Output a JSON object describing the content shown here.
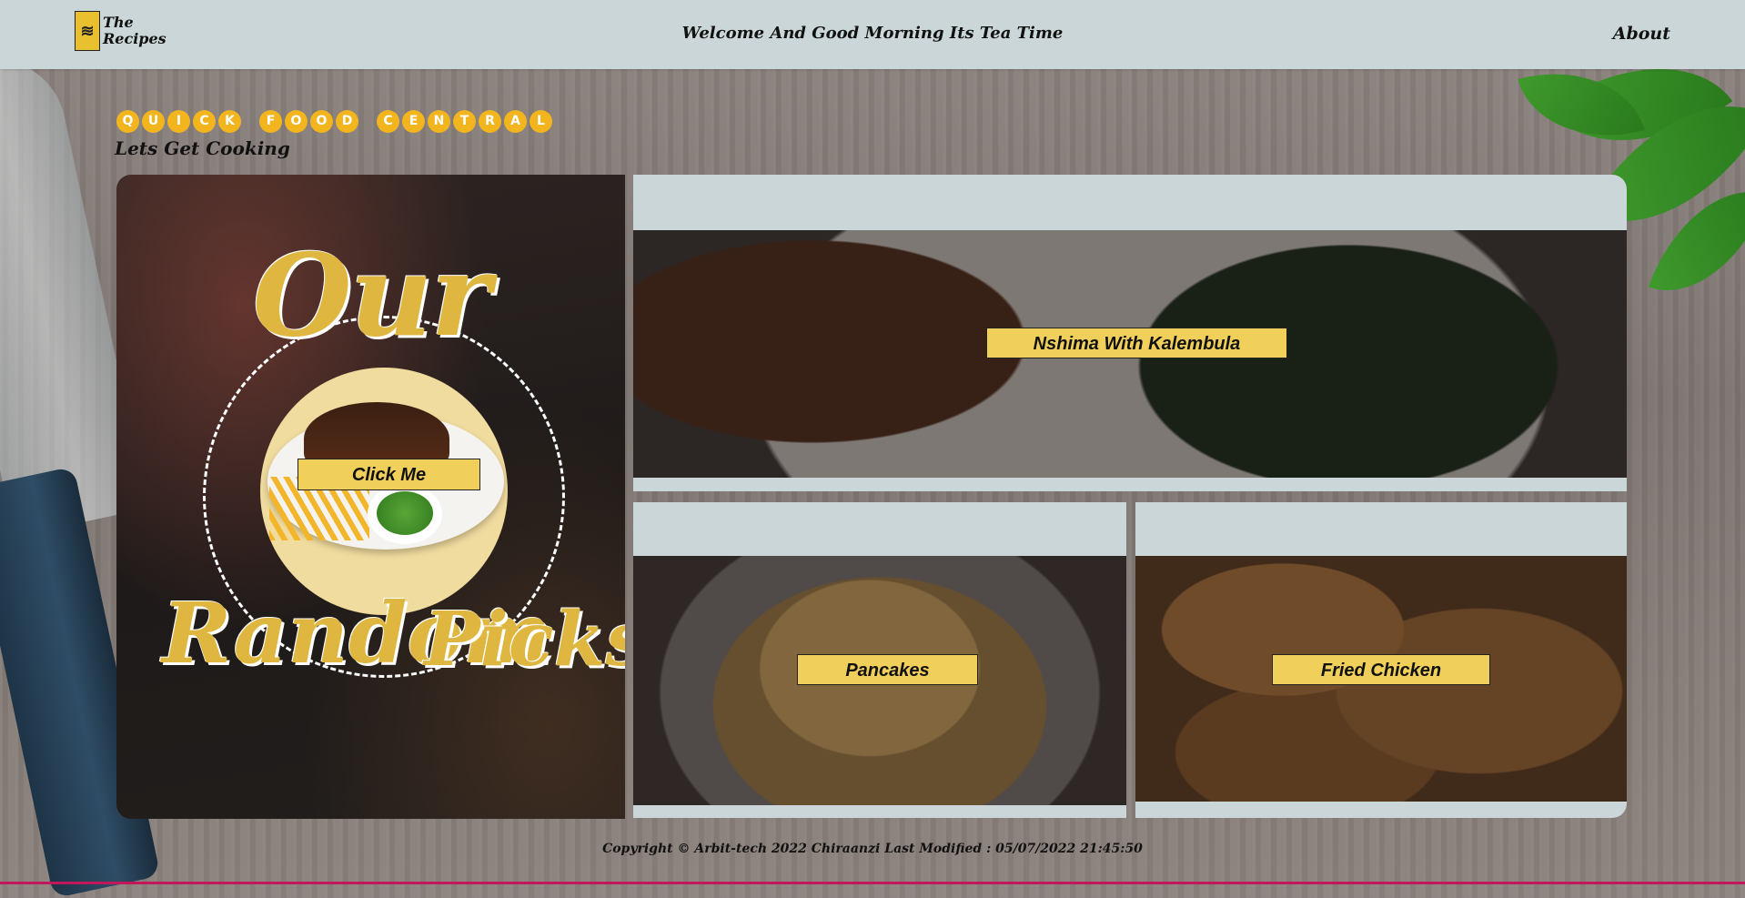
{
  "header": {
    "logo_mark": "≋",
    "logo_line1": "The",
    "logo_line2": "Recipes",
    "welcome": "Welcome And Good Morning Its Tea Time",
    "about": "About"
  },
  "hero_section": {
    "brand_letters": [
      "Q",
      "U",
      "I",
      "C",
      "K",
      " ",
      "F",
      "O",
      "O",
      "D",
      " ",
      "C",
      "E",
      "N",
      "T",
      "R",
      "A",
      "L"
    ],
    "subtitle": "Lets Get Cooking",
    "title_top": "Our",
    "title_bottom_left": "Random",
    "title_bottom_right": "Picks",
    "cta_label": "Click Me"
  },
  "recipes": [
    {
      "label": "Nshima With Kalembula"
    },
    {
      "label": "Pancakes"
    },
    {
      "label": "Fried Chicken"
    }
  ],
  "footer": {
    "text": "Copyright © Arbit-tech 2022 Chiraanzi Last Modified : 05/07/2022 21:45:50"
  },
  "colors": {
    "accent": "#f1cf5b",
    "brand_yellow": "#f2b51e",
    "title_gold": "#dfb740",
    "bar_bg": "#cad6d7"
  },
  "icons": [
    "logo-mark-icon"
  ]
}
